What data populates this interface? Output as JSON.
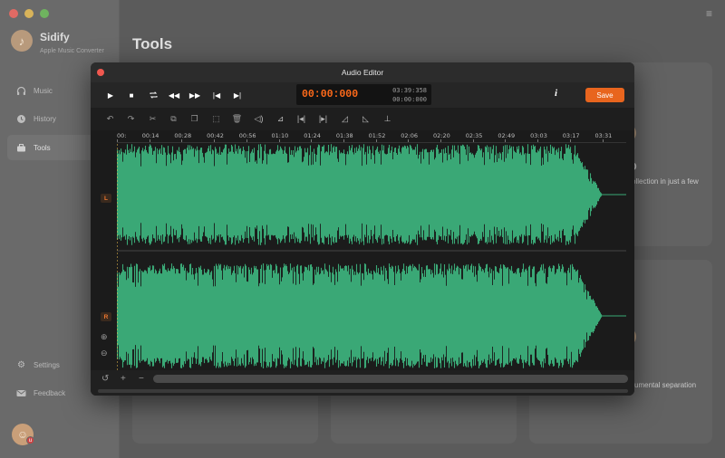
{
  "app": {
    "name": "Sidify",
    "subtitle": "Apple Music Converter"
  },
  "nav": [
    {
      "label": "Music",
      "icon": "headphones-icon"
    },
    {
      "label": "History",
      "icon": "clock-icon"
    },
    {
      "label": "Tools",
      "icon": "toolbox-icon",
      "active": true
    }
  ],
  "nav_bottom": [
    {
      "label": "Settings",
      "icon": "gear-icon"
    },
    {
      "label": "Feedback",
      "icon": "mail-icon"
    }
  ],
  "page_title": "Tools",
  "cards": {
    "card1_text": "ollection in just a few",
    "card1_letter": "D",
    "card2_text": "umental separation"
  },
  "editor": {
    "title": "Audio Editor",
    "time_current": "00:00:000",
    "time_total": "03:39:358",
    "time_selection": "00:00:000",
    "save_label": "Save",
    "info_label": "i",
    "channels": {
      "left": "L",
      "right": "R"
    },
    "ruler_ticks": [
      "00:",
      "00:14",
      "00:28",
      "00:42",
      "00:56",
      "01:10",
      "01:24",
      "01:38",
      "01:52",
      "02:06",
      "02:20",
      "02:35",
      "02:49",
      "03:03",
      "03:17",
      "03:31"
    ],
    "wave_color": "#3aa876"
  },
  "colors": {
    "accent": "#e8651e",
    "time": "#ff6a1a",
    "close": "#f0584f"
  }
}
